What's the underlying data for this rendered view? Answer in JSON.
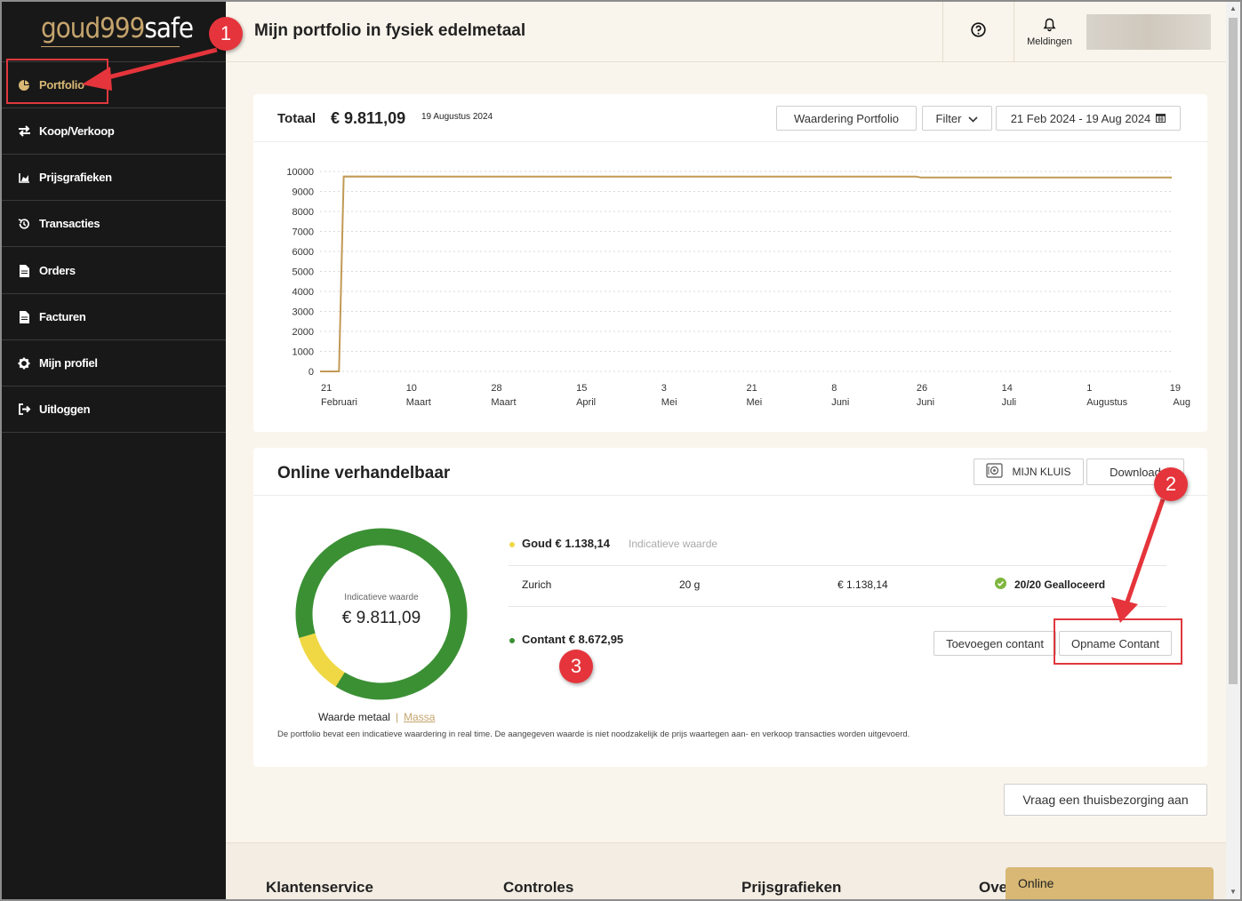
{
  "sidebar": {
    "logo_a": "goud999",
    "logo_b": "safe",
    "items": [
      {
        "label": "Portfolio"
      },
      {
        "label": "Koop/Verkoop"
      },
      {
        "label": "Prijsgrafieken"
      },
      {
        "label": "Transacties"
      },
      {
        "label": "Orders"
      },
      {
        "label": "Facturen"
      },
      {
        "label": "Mijn profiel"
      },
      {
        "label": "Uitloggen"
      }
    ]
  },
  "header": {
    "title": "Mijn portfolio in fysiek edelmetaal",
    "notifications_label": "Meldingen"
  },
  "portfolio": {
    "totaal_label": "Totaal",
    "totaal_value": "€ 9.811,09",
    "date": "19 Augustus 2024",
    "waardering_button": "Waardering Portfolio",
    "filter_button": "Filter",
    "range_button": "21 Feb 2024 - 19 Aug 2024"
  },
  "chart_data": {
    "type": "line",
    "ylim": [
      0,
      10000
    ],
    "y_ticks": [
      "0",
      "1000",
      "2000",
      "3000",
      "4000",
      "5000",
      "6000",
      "7000",
      "8000",
      "9000",
      "10000"
    ],
    "x_ticks": [
      {
        "day": "21",
        "month": "Februari"
      },
      {
        "day": "10",
        "month": "Maart"
      },
      {
        "day": "28",
        "month": "Maart"
      },
      {
        "day": "15",
        "month": "April"
      },
      {
        "day": "3",
        "month": "Mei"
      },
      {
        "day": "21",
        "month": "Mei"
      },
      {
        "day": "8",
        "month": "Juni"
      },
      {
        "day": "26",
        "month": "Juni"
      },
      {
        "day": "14",
        "month": "Juli"
      },
      {
        "day": "1",
        "month": "Augustus"
      },
      {
        "day": "19",
        "month": "Aug"
      }
    ],
    "series": [
      {
        "color": "#c19a55",
        "points": [
          {
            "x": "2024-02-21",
            "y": 0
          },
          {
            "x": "2024-02-25",
            "y": 0
          },
          {
            "x": "2024-02-26",
            "y": 9750
          },
          {
            "x": "2024-04-15",
            "y": 9740
          },
          {
            "x": "2024-06-26",
            "y": 9740
          },
          {
            "x": "2024-06-27",
            "y": 9700
          },
          {
            "x": "2024-08-19",
            "y": 9700
          }
        ]
      }
    ],
    "grid": true
  },
  "online": {
    "title": "Online verhandelbaar",
    "kluis_button": "MIJN KLUIS",
    "download_button": "Download",
    "donut_label": "Indicatieve waarde",
    "donut_value": "€ 9.811,09",
    "donut_slices": [
      {
        "name": "Goud",
        "value": 1138.14,
        "color": "#f0d844"
      },
      {
        "name": "Contant",
        "value": 8672.95,
        "color": "#3b9034"
      }
    ],
    "goud_line": "Goud € 1.138,14",
    "goud_indicative": "Indicatieve waarde",
    "row": {
      "location": "Zurich",
      "weight": "20 g",
      "value": "€ 1.138,14",
      "status": "20/20 Gealloceerd"
    },
    "contant_line": "Contant € 8.672,95",
    "toevoegen_button": "Toevoegen contant",
    "opname_button": "Opname Contant",
    "switch_a": "Waarde metaal",
    "switch_sep": "|",
    "switch_b": "Massa",
    "disclaimer": "De portfolio bevat een indicatieve waardering in real time. De aangegeven waarde is niet noodzakelijk de prijs waartegen aan- en verkoop transacties worden uitgevoerd.",
    "colors": {
      "goud": "#f0d844",
      "contant": "#3b9034"
    }
  },
  "thuisbezorging_button": "Vraag een thuisbezorging aan",
  "footer": {
    "headings": [
      "Klantenservice",
      "Controles",
      "Prijsgrafieken",
      "Ove"
    ],
    "online_tab": "Online"
  },
  "annotations": {
    "badges": [
      "1",
      "2",
      "3"
    ]
  }
}
